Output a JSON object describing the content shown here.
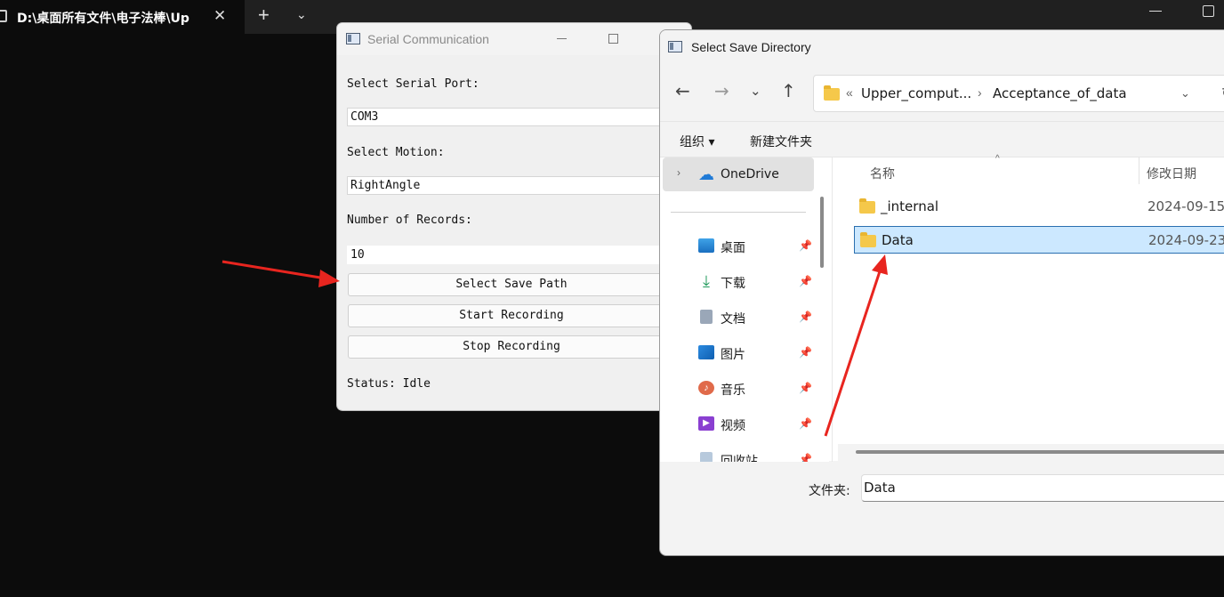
{
  "terminal": {
    "tab_title": "D:\\桌面所有文件\\电子法棒\\Up",
    "close_glyph": "✕",
    "new_tab_glyph": "+",
    "dropdown_glyph": "⌄"
  },
  "serial_window": {
    "title": "Serial Communication",
    "port_label": "Select Serial Port:",
    "port_value": "COM3",
    "motion_label": "Select Motion:",
    "motion_value": "RightAngle",
    "records_label": "Number of Records:",
    "records_value": "10",
    "select_path_button": "Select Save Path",
    "start_button": "Start Recording",
    "stop_button": "Stop Recording",
    "status_text": "Status: Idle"
  },
  "save_dialog": {
    "title": "Select Save Directory",
    "breadcrumb": {
      "prefix": "«",
      "parent": "Upper_comput...",
      "separator": "›",
      "current": "Acceptance_of_data"
    },
    "commands": {
      "organize": "组织 ▾",
      "new_folder": "新建文件夹"
    },
    "nav_items": [
      {
        "label": "OneDrive",
        "icon": "cloud-icon"
      },
      {
        "label": "桌面",
        "icon": "desktop-icon"
      },
      {
        "label": "下载",
        "icon": "download-icon"
      },
      {
        "label": "文档",
        "icon": "document-icon"
      },
      {
        "label": "图片",
        "icon": "pictures-icon"
      },
      {
        "label": "音乐",
        "icon": "music-icon"
      },
      {
        "label": "视频",
        "icon": "video-icon"
      },
      {
        "label": "回收站",
        "icon": "recycle-bin-icon"
      }
    ],
    "columns": {
      "name": "名称",
      "modified": "修改日期"
    },
    "files": [
      {
        "name": "_internal",
        "date": "2024-09-15"
      },
      {
        "name": "Data",
        "date": "2024-09-23"
      }
    ],
    "folder_label": "文件夹:",
    "folder_value": "Data",
    "colors": {
      "selection": "#cce8ff",
      "selection_border": "#2a6fb0",
      "annotation_arrow": "#e8251f"
    }
  }
}
